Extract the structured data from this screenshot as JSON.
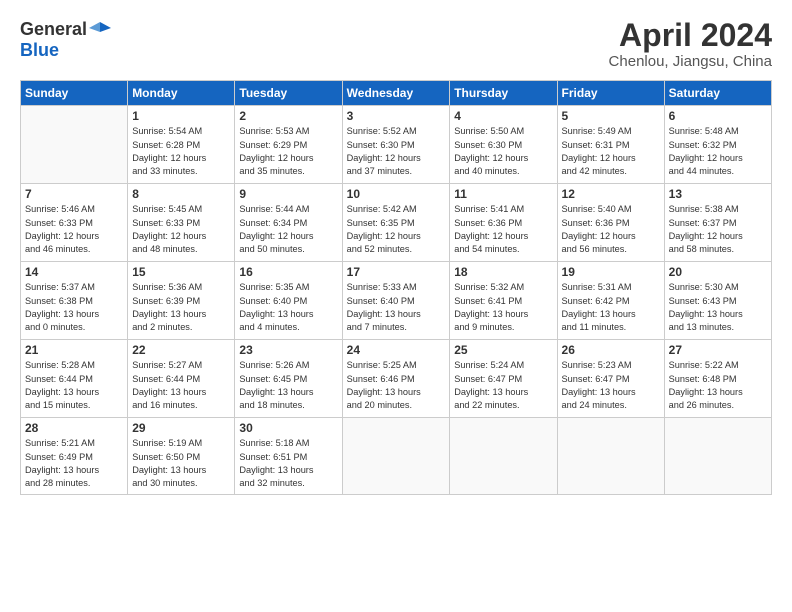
{
  "header": {
    "logo_general": "General",
    "logo_blue": "Blue",
    "title": "April 2024",
    "subtitle": "Chenlou, Jiangsu, China"
  },
  "days_of_week": [
    "Sunday",
    "Monday",
    "Tuesday",
    "Wednesday",
    "Thursday",
    "Friday",
    "Saturday"
  ],
  "weeks": [
    [
      {
        "day": "",
        "info": ""
      },
      {
        "day": "1",
        "info": "Sunrise: 5:54 AM\nSunset: 6:28 PM\nDaylight: 12 hours\nand 33 minutes."
      },
      {
        "day": "2",
        "info": "Sunrise: 5:53 AM\nSunset: 6:29 PM\nDaylight: 12 hours\nand 35 minutes."
      },
      {
        "day": "3",
        "info": "Sunrise: 5:52 AM\nSunset: 6:30 PM\nDaylight: 12 hours\nand 37 minutes."
      },
      {
        "day": "4",
        "info": "Sunrise: 5:50 AM\nSunset: 6:30 PM\nDaylight: 12 hours\nand 40 minutes."
      },
      {
        "day": "5",
        "info": "Sunrise: 5:49 AM\nSunset: 6:31 PM\nDaylight: 12 hours\nand 42 minutes."
      },
      {
        "day": "6",
        "info": "Sunrise: 5:48 AM\nSunset: 6:32 PM\nDaylight: 12 hours\nand 44 minutes."
      }
    ],
    [
      {
        "day": "7",
        "info": "Sunrise: 5:46 AM\nSunset: 6:33 PM\nDaylight: 12 hours\nand 46 minutes."
      },
      {
        "day": "8",
        "info": "Sunrise: 5:45 AM\nSunset: 6:33 PM\nDaylight: 12 hours\nand 48 minutes."
      },
      {
        "day": "9",
        "info": "Sunrise: 5:44 AM\nSunset: 6:34 PM\nDaylight: 12 hours\nand 50 minutes."
      },
      {
        "day": "10",
        "info": "Sunrise: 5:42 AM\nSunset: 6:35 PM\nDaylight: 12 hours\nand 52 minutes."
      },
      {
        "day": "11",
        "info": "Sunrise: 5:41 AM\nSunset: 6:36 PM\nDaylight: 12 hours\nand 54 minutes."
      },
      {
        "day": "12",
        "info": "Sunrise: 5:40 AM\nSunset: 6:36 PM\nDaylight: 12 hours\nand 56 minutes."
      },
      {
        "day": "13",
        "info": "Sunrise: 5:38 AM\nSunset: 6:37 PM\nDaylight: 12 hours\nand 58 minutes."
      }
    ],
    [
      {
        "day": "14",
        "info": "Sunrise: 5:37 AM\nSunset: 6:38 PM\nDaylight: 13 hours\nand 0 minutes."
      },
      {
        "day": "15",
        "info": "Sunrise: 5:36 AM\nSunset: 6:39 PM\nDaylight: 13 hours\nand 2 minutes."
      },
      {
        "day": "16",
        "info": "Sunrise: 5:35 AM\nSunset: 6:40 PM\nDaylight: 13 hours\nand 4 minutes."
      },
      {
        "day": "17",
        "info": "Sunrise: 5:33 AM\nSunset: 6:40 PM\nDaylight: 13 hours\nand 7 minutes."
      },
      {
        "day": "18",
        "info": "Sunrise: 5:32 AM\nSunset: 6:41 PM\nDaylight: 13 hours\nand 9 minutes."
      },
      {
        "day": "19",
        "info": "Sunrise: 5:31 AM\nSunset: 6:42 PM\nDaylight: 13 hours\nand 11 minutes."
      },
      {
        "day": "20",
        "info": "Sunrise: 5:30 AM\nSunset: 6:43 PM\nDaylight: 13 hours\nand 13 minutes."
      }
    ],
    [
      {
        "day": "21",
        "info": "Sunrise: 5:28 AM\nSunset: 6:44 PM\nDaylight: 13 hours\nand 15 minutes."
      },
      {
        "day": "22",
        "info": "Sunrise: 5:27 AM\nSunset: 6:44 PM\nDaylight: 13 hours\nand 16 minutes."
      },
      {
        "day": "23",
        "info": "Sunrise: 5:26 AM\nSunset: 6:45 PM\nDaylight: 13 hours\nand 18 minutes."
      },
      {
        "day": "24",
        "info": "Sunrise: 5:25 AM\nSunset: 6:46 PM\nDaylight: 13 hours\nand 20 minutes."
      },
      {
        "day": "25",
        "info": "Sunrise: 5:24 AM\nSunset: 6:47 PM\nDaylight: 13 hours\nand 22 minutes."
      },
      {
        "day": "26",
        "info": "Sunrise: 5:23 AM\nSunset: 6:47 PM\nDaylight: 13 hours\nand 24 minutes."
      },
      {
        "day": "27",
        "info": "Sunrise: 5:22 AM\nSunset: 6:48 PM\nDaylight: 13 hours\nand 26 minutes."
      }
    ],
    [
      {
        "day": "28",
        "info": "Sunrise: 5:21 AM\nSunset: 6:49 PM\nDaylight: 13 hours\nand 28 minutes."
      },
      {
        "day": "29",
        "info": "Sunrise: 5:19 AM\nSunset: 6:50 PM\nDaylight: 13 hours\nand 30 minutes."
      },
      {
        "day": "30",
        "info": "Sunrise: 5:18 AM\nSunset: 6:51 PM\nDaylight: 13 hours\nand 32 minutes."
      },
      {
        "day": "",
        "info": ""
      },
      {
        "day": "",
        "info": ""
      },
      {
        "day": "",
        "info": ""
      },
      {
        "day": "",
        "info": ""
      }
    ]
  ]
}
